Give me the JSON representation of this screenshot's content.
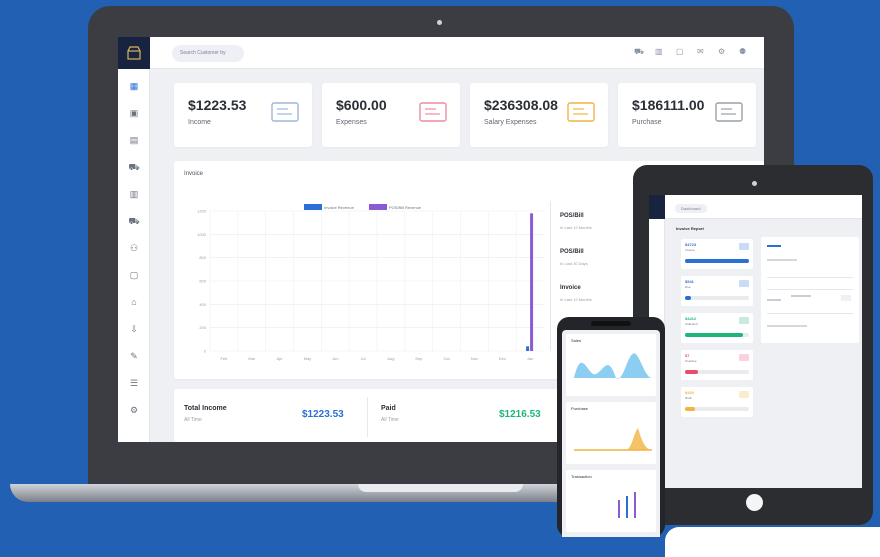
{
  "laptop": {
    "search": {
      "placeholder": "Search Customer by"
    },
    "topbar_icons": [
      "cart-icon",
      "report-icon",
      "calculator-icon",
      "chat-icon",
      "gear-icon",
      "user-icon"
    ],
    "sidebar_icons": [
      "dashboard-icon",
      "box-icon",
      "document-icon",
      "cart-icon",
      "report-icon",
      "truck-icon",
      "people-icon",
      "calculator-icon",
      "bank-icon",
      "download-icon",
      "pencil-icon",
      "list-icon",
      "settings-icon"
    ],
    "stats": [
      {
        "value": "$1223.53",
        "label": "Income",
        "icon": "cheque-icon",
        "color": "#9db5d8"
      },
      {
        "value": "$600.00",
        "label": "Expenses",
        "icon": "printer-icon",
        "color": "#f08aa0"
      },
      {
        "value": "$236308.08",
        "label": "Salary Expenses",
        "icon": "hand-money-icon",
        "color": "#f2b441"
      },
      {
        "value": "$186111.00",
        "label": "Purchase",
        "icon": "invoice-icon",
        "color": "#9aa0aa"
      }
    ],
    "invoice_panel": {
      "title": "Invoice",
      "legend": [
        {
          "name": "Invoice Revenue",
          "color": "#2b6fd6"
        },
        {
          "name": "POS/Bill Revenue",
          "color": "#8a5bd1"
        }
      ],
      "side_list": [
        {
          "title": "POS/Bill",
          "sub": "In Last 12 Months"
        },
        {
          "title": "POS/Bill",
          "sub": "In Last 30 Days"
        },
        {
          "title": "Invoice",
          "sub": "In Last 12 Months"
        }
      ]
    },
    "totals": [
      {
        "label": "Total Income",
        "sub": "All Time",
        "value": "$1223.53",
        "color": "#2b6fd6"
      },
      {
        "label": "Paid",
        "sub": "All Time",
        "value": "$1216.53",
        "color": "#1fb57a"
      }
    ]
  },
  "chart_data": {
    "type": "bar",
    "title": "Invoice",
    "categories": [
      "Feb",
      "Mar",
      "Apr",
      "May",
      "Jun",
      "Jul",
      "Aug",
      "Sep",
      "Oct",
      "Nov",
      "Dec",
      "Jan"
    ],
    "y_ticks": [
      "1200",
      "1000",
      "800",
      "600",
      "400",
      "200",
      "0"
    ],
    "ylim": [
      0,
      1200
    ],
    "series": [
      {
        "name": "Invoice Revenue",
        "color": "#2b6fd6",
        "values": [
          0,
          0,
          0,
          0,
          0,
          0,
          0,
          0,
          0,
          0,
          0,
          40
        ]
      },
      {
        "name": "POS/Bill Revenue",
        "color": "#8a5bd1",
        "values": [
          0,
          0,
          0,
          0,
          0,
          0,
          0,
          0,
          0,
          0,
          0,
          1180
        ]
      }
    ],
    "grid": true,
    "legend": "top-center"
  },
  "tablet": {
    "tab_label": "Dashboard",
    "section": "Invoice Report",
    "mini_stats": [
      {
        "value": "$4723",
        "label": "Invoice",
        "color": "#2b6fd6",
        "progress": 1.0
      },
      {
        "value": "$541",
        "label": "Due",
        "color": "#2b6fd6",
        "progress": 0.1
      },
      {
        "value": "$4412",
        "label": "Collected",
        "color": "#1fb57a",
        "progress": 0.9
      },
      {
        "value": "$7",
        "label": "Overdue",
        "color": "#e94b6e",
        "progress": 0.2
      },
      {
        "value": "$420",
        "label": "Draft",
        "color": "#f2b441",
        "progress": 0.15
      }
    ]
  },
  "phone": {
    "cards": [
      {
        "title": "Sales",
        "color": "#2ea4e8"
      },
      {
        "title": "Purchase",
        "color": "#f2b441"
      },
      {
        "title": "Transaction",
        "color": "#8a5bd1"
      }
    ]
  }
}
